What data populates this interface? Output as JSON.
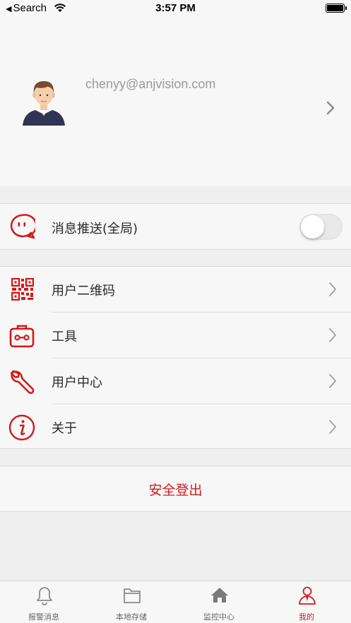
{
  "status_bar": {
    "back_label": "Search",
    "time": "3:57 PM"
  },
  "profile": {
    "email": "chenyy@anjvision.com",
    "avatar_icon": "user-avatar-icon"
  },
  "push": {
    "label": "消息推送(全局)",
    "icon": "message-bubble-icon",
    "enabled": false
  },
  "menu": [
    {
      "label": "用户二维码",
      "icon": "qr-code-icon"
    },
    {
      "label": "工具",
      "icon": "toolbox-icon"
    },
    {
      "label": "用户中心",
      "icon": "wrench-icon"
    },
    {
      "label": "关于",
      "icon": "info-icon"
    }
  ],
  "logout": {
    "label": "安全登出"
  },
  "tabs": [
    {
      "label": "报警消息",
      "icon": "bell-icon",
      "active": false
    },
    {
      "label": "本地存储",
      "icon": "folder-icon",
      "active": false
    },
    {
      "label": "监控中心",
      "icon": "home-icon",
      "active": false
    },
    {
      "label": "我的",
      "icon": "person-icon",
      "active": true
    }
  ],
  "colors": {
    "accent": "#d11a1a",
    "background": "#efefef",
    "cell": "#f7f7f7",
    "email_text": "#9a9a9a"
  }
}
